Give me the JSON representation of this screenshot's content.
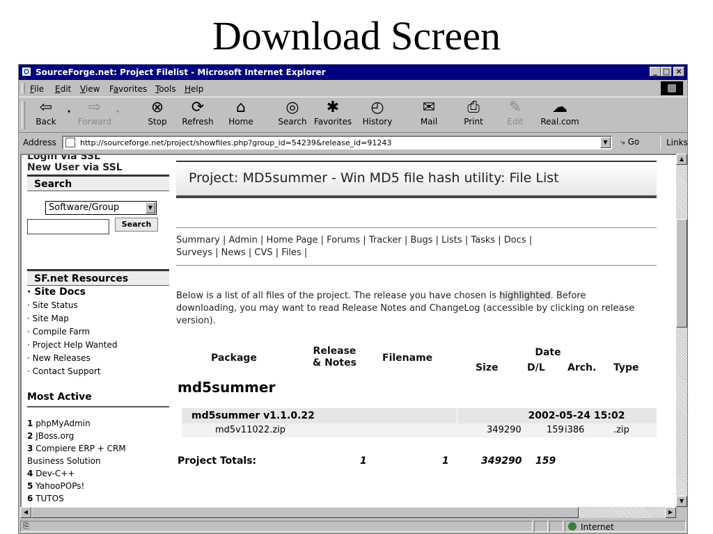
{
  "slide": {
    "title": "Download Screen"
  },
  "window": {
    "title": "SourceForge.net: Project Filelist - Microsoft Internet Explorer",
    "controls": {
      "minimize": "_",
      "maximize": "□",
      "close": "×"
    }
  },
  "menu": {
    "items": [
      {
        "label": "File",
        "accel": "F",
        "rest": "ile"
      },
      {
        "label": "Edit",
        "accel": "E",
        "rest": "dit"
      },
      {
        "label": "View",
        "accel": "V",
        "rest": "iew"
      },
      {
        "label": "Favorites",
        "accel": "a",
        "rest": "vorites",
        "pre": "F"
      },
      {
        "label": "Tools",
        "accel": "T",
        "rest": "ools"
      },
      {
        "label": "Help",
        "accel": "H",
        "rest": "elp"
      }
    ]
  },
  "toolbar": {
    "back": "Back",
    "forward": "Forward",
    "stop": "Stop",
    "refresh": "Refresh",
    "home": "Home",
    "search": "Search",
    "favorites": "Favorites",
    "history": "History",
    "mail": "Mail",
    "print": "Print",
    "edit": "Edit",
    "realcom": "Real.com"
  },
  "address": {
    "label": "Address",
    "url": "http://sourceforge.net/project/showfiles.php?group_id=54239&release_id=91243",
    "go": "Go",
    "links": "Links"
  },
  "sidebar": {
    "login_ssl": "Login via SSL",
    "new_user_ssl": "New User via SSL",
    "search_header": "Search",
    "search_select": "Software/Group",
    "search_button": "Search",
    "resources_header": "SF.net Resources",
    "resources": [
      "Site Docs",
      "Site Status",
      "Site Map",
      "Compile Farm",
      "Project Help Wanted",
      "New Releases",
      "Contact Support"
    ],
    "most_active_header": "Most Active",
    "most_active": [
      {
        "rank": "1",
        "name": "phpMyAdmin"
      },
      {
        "rank": "2",
        "name": "JBoss.org"
      },
      {
        "rank": "3",
        "name": "Compiere ERP + CRM"
      },
      {
        "rank": "",
        "name": "Business Solution"
      },
      {
        "rank": "4",
        "name": "Dev-C++"
      },
      {
        "rank": "5",
        "name": "YahooPOPs!"
      },
      {
        "rank": "6",
        "name": "TUTOS"
      }
    ]
  },
  "main": {
    "project_title": "Project: MD5summer - Win MD5 file hash utility: File List",
    "tabs_line1": "Summary | Admin | Home Page | Forums | Tracker | Bugs | Lists | Tasks | Docs |",
    "tabs_line2": "Surveys | News | CVS | Files |",
    "intro_before": "Below is a list of all files of the project. The release you have chosen is ",
    "intro_highlight": "highlighted",
    "intro_after": ". Before downloading, you may want to read Release Notes and ChangeLog (accessible by clicking on release version).",
    "columns": {
      "package": "Package",
      "release_notes_1": "Release",
      "release_notes_2": "& Notes",
      "filename": "Filename",
      "size": "Size",
      "date": "Date",
      "dl": "D/L",
      "arch": "Arch.",
      "type": "Type"
    },
    "package_name": "md5summer",
    "release": {
      "name": "md5summer v1.1.0.22",
      "date": "2002-05-24 15:02"
    },
    "file": {
      "name": "md5v11022.zip",
      "size": "349290",
      "dl": "159",
      "arch": "i386",
      "type": ".zip"
    },
    "totals": {
      "label": "Project Totals:",
      "releases": "1",
      "files": "1",
      "size": "349290",
      "dl": "159"
    }
  },
  "status": {
    "zone": "Internet"
  }
}
